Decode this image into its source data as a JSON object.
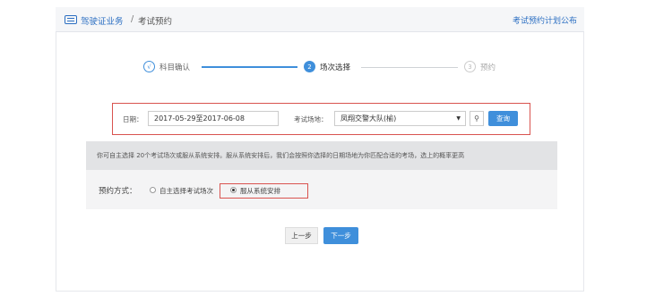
{
  "header": {
    "breadcrumb_main": "驾驶证业务",
    "breadcrumb_sep": "/",
    "breadcrumb_sub": "考试预约",
    "plan_link": "考试预约计划公布"
  },
  "steps": [
    {
      "index": "√",
      "label": "科目确认",
      "state": "done"
    },
    {
      "index": "2",
      "label": "场次选择",
      "state": "active"
    },
    {
      "index": "3",
      "label": "预约",
      "state": "pending"
    }
  ],
  "filter": {
    "date_label": "日期：",
    "date_value": "2017-05-29至2017-06-08",
    "venue_label": "考试场地：",
    "venue_value": "凤翔交警大队(榆)",
    "search_label": "查询"
  },
  "tip_text": "你可自主选择 20个考试场次或服从系统安排。服从系统安排后，我们会按照你选择的日期场地为你匹配合适的考场，选上的概率更高",
  "mode": {
    "label": "预约方式：",
    "options": [
      {
        "label": "自主选择考试场次",
        "selected": false
      },
      {
        "label": "服从系统安排",
        "selected": true
      }
    ]
  },
  "buttons": {
    "prev": "上一步",
    "next": "下一步"
  },
  "colors": {
    "primary": "#3f8fdb",
    "highlight_border": "#d9534f"
  }
}
